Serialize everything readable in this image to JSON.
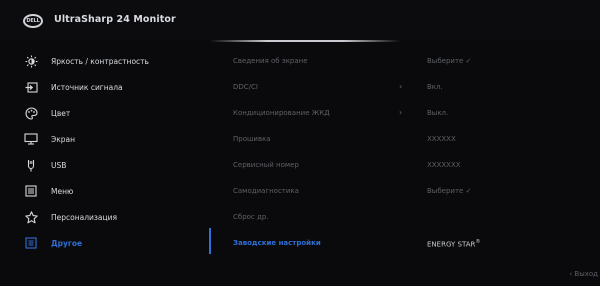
{
  "header": {
    "logo_text": "DELL",
    "title": "UltraSharp 24 Monitor"
  },
  "sidebar": {
    "items": [
      {
        "label": "Яркость / контрастность",
        "icon": "brightness-icon"
      },
      {
        "label": "Источник сигнала",
        "icon": "input-source-icon"
      },
      {
        "label": "Цвет",
        "icon": "color-palette-icon"
      },
      {
        "label": "Экран",
        "icon": "display-icon"
      },
      {
        "label": "USB",
        "icon": "usb-icon"
      },
      {
        "label": "Меню",
        "icon": "menu-icon"
      },
      {
        "label": "Персонализация",
        "icon": "star-icon"
      },
      {
        "label": "Другое",
        "icon": "other-icon",
        "active": true
      }
    ]
  },
  "content": {
    "rows": [
      {
        "label": "Сведения об экране",
        "value": "Выберите ✓"
      },
      {
        "label": "DDC/CI",
        "value": "Вкл.",
        "arrow": "›"
      },
      {
        "label": "Кондиционирование ЖКД",
        "value": "Выкл.",
        "arrow": "›"
      },
      {
        "label": "Прошивка",
        "value": "XXXXXX"
      },
      {
        "label": "Сервисный номер",
        "value": "XXXXXXX"
      },
      {
        "label": "Самодиагностика",
        "value": "Выберите ✓"
      },
      {
        "label": "Сброс др.",
        "value": ""
      },
      {
        "label": "Заводские настройки",
        "value": "ENERGY STAR",
        "value_sup": "®",
        "active": true
      }
    ]
  },
  "footer": {
    "exit_label": "‹ Выход"
  },
  "colors": {
    "accent": "#2f6fd6",
    "text": "#d8dbe0",
    "muted": "#5d6066",
    "background": "#0a0a0c"
  }
}
